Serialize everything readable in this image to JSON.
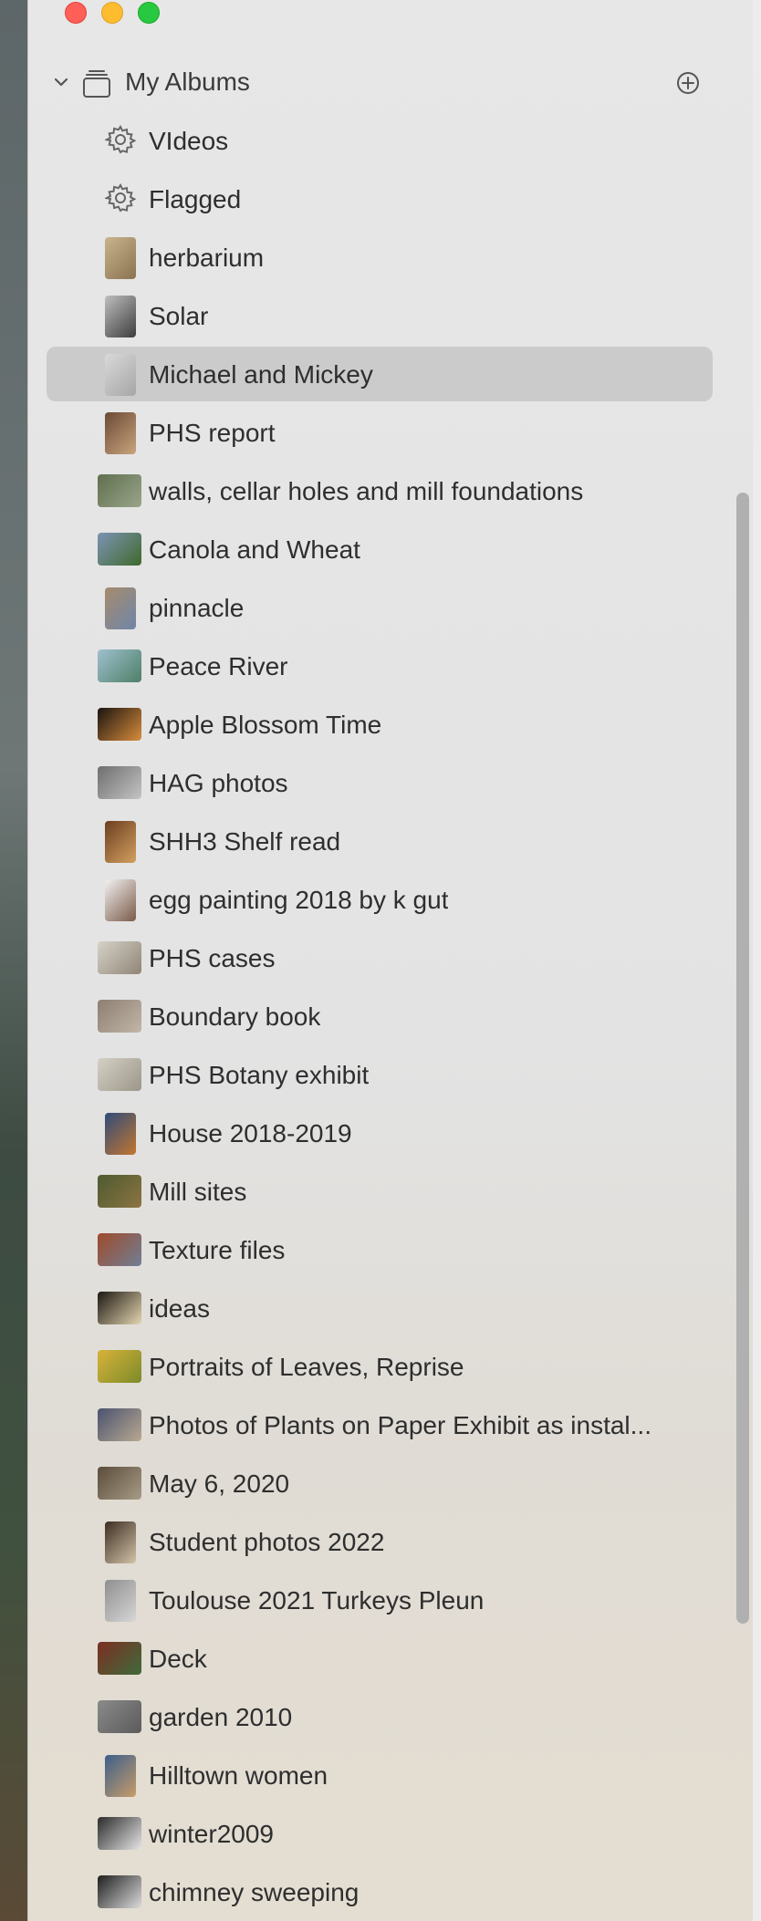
{
  "window": {
    "controls": [
      "close",
      "minimize",
      "zoom"
    ]
  },
  "section": {
    "title": "My Albums",
    "icons": {
      "collapse": "chevron-down-icon",
      "folder": "album-stack-icon",
      "add": "plus-circle-icon"
    }
  },
  "albums": [
    {
      "label": "VIdeos",
      "icon": "gear-icon",
      "selected": false
    },
    {
      "label": "Flagged",
      "icon": "gear-icon",
      "selected": false
    },
    {
      "label": "herbarium",
      "thumb": "#c8b48e",
      "thumb2": "#8a7350",
      "portrait": true
    },
    {
      "label": "Solar",
      "thumb": "#bfbfbf",
      "thumb2": "#3d3d3d",
      "portrait": true
    },
    {
      "label": "Michael and Mickey",
      "thumb": "#d9d9d9",
      "thumb2": "#a6a6a6",
      "portrait": true,
      "selected": true
    },
    {
      "label": "PHS report",
      "thumb": "#6b4a34",
      "thumb2": "#c9a47d",
      "portrait": true
    },
    {
      "label": "walls, cellar holes and mill foundations",
      "thumb": "#5f6f4e",
      "thumb2": "#9aa58b"
    },
    {
      "label": "Canola and Wheat",
      "thumb": "#7d93b5",
      "thumb2": "#3f6a2c"
    },
    {
      "label": "pinnacle",
      "thumb": "#a78b6c",
      "thumb2": "#6f86a9",
      "portrait": true
    },
    {
      "label": "Peace River",
      "thumb": "#9fc0cf",
      "thumb2": "#4d7f66"
    },
    {
      "label": "Apple Blossom Time",
      "thumb": "#1a1410",
      "thumb2": "#d98d3c"
    },
    {
      "label": "HAG photos",
      "thumb": "#6e6e6e",
      "thumb2": "#c4c4c4"
    },
    {
      "label": "SHH3 Shelf read",
      "thumb": "#6b3e1f",
      "thumb2": "#d3a060",
      "portrait": true
    },
    {
      "label": "egg painting 2018 by k gut",
      "thumb": "#f2f2f2",
      "thumb2": "#7a5a48",
      "portrait": true
    },
    {
      "label": "PHS cases",
      "thumb": "#d6d2c8",
      "thumb2": "#8f8576"
    },
    {
      "label": "Boundary book",
      "thumb": "#8c7f72",
      "thumb2": "#c2b6a8"
    },
    {
      "label": "PHS Botany exhibit",
      "thumb": "#d5d0c4",
      "thumb2": "#9c968a"
    },
    {
      "label": "House 2018-2019",
      "thumb": "#2f4b7a",
      "thumb2": "#c2762f",
      "portrait": true
    },
    {
      "label": "Mill sites",
      "thumb": "#4d5a30",
      "thumb2": "#8c7442"
    },
    {
      "label": "Texture files",
      "thumb": "#a04a2a",
      "thumb2": "#6f7f96"
    },
    {
      "label": "ideas",
      "thumb": "#1c1712",
      "thumb2": "#e4d6b0"
    },
    {
      "label": "Portraits of Leaves, Reprise",
      "thumb": "#d8b23a",
      "thumb2": "#7c8b2a"
    },
    {
      "label": "Photos of Plants on Paper Exhibit as instal...",
      "thumb": "#4b5370",
      "thumb2": "#b8a890"
    },
    {
      "label": "May 6, 2020",
      "thumb": "#5a4c3a",
      "thumb2": "#a79c86"
    },
    {
      "label": "Student photos 2022",
      "thumb": "#3d2d23",
      "thumb2": "#d2c3a8",
      "portrait": true
    },
    {
      "label": "Toulouse 2021 Turkeys Pleun",
      "thumb": "#8f8f8f",
      "thumb2": "#d6d6d6",
      "portrait": true
    },
    {
      "label": "Deck",
      "thumb": "#7c2e22",
      "thumb2": "#3e6b3b"
    },
    {
      "label": "garden 2010",
      "thumb": "#8a8a8a",
      "thumb2": "#5b5b5b"
    },
    {
      "label": "Hilltown women",
      "thumb": "#3c5f8a",
      "thumb2": "#c79c6a",
      "portrait": true
    },
    {
      "label": "winter2009",
      "thumb": "#2b2b2b",
      "thumb2": "#e6e6e6"
    },
    {
      "label": "chimney sweeping",
      "thumb": "#1e1e1e",
      "thumb2": "#dcdcdc"
    }
  ]
}
